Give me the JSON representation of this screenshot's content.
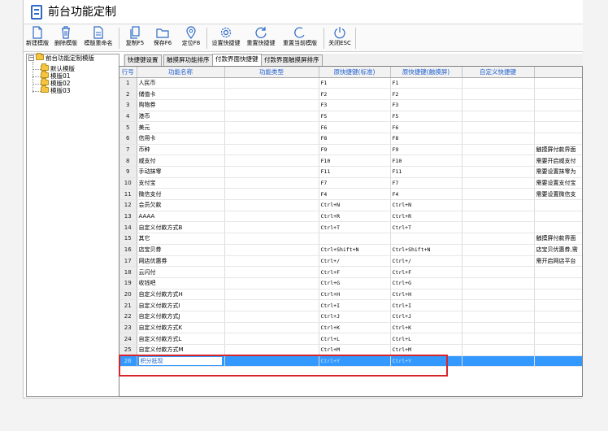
{
  "window": {
    "title": "前台功能定制"
  },
  "toolbar": {
    "buttons": [
      {
        "label": "新建模版",
        "icon": "new-document-icon"
      },
      {
        "label": "删除模版",
        "icon": "trash-icon"
      },
      {
        "label": "模版重命名",
        "icon": "rename-document-icon"
      },
      {
        "label": "复制F5",
        "icon": "copy-icon"
      },
      {
        "label": "保存F6",
        "icon": "folder-icon"
      },
      {
        "label": "定位F8",
        "icon": "location-pin-icon"
      },
      {
        "label": "设置快捷键",
        "icon": "gear-icon"
      },
      {
        "label": "重置快捷键",
        "icon": "refresh-icon"
      },
      {
        "label": "重置当前模版",
        "icon": "reset-icon"
      },
      {
        "label": "关闭ESC",
        "icon": "power-icon"
      }
    ]
  },
  "tree": {
    "root": "前台功能定制模版",
    "items": [
      "默认模版",
      "模版01",
      "模版02",
      "模版03"
    ]
  },
  "tabs": [
    {
      "label": "快捷键设置",
      "active": false
    },
    {
      "label": "触摸屏功能排序",
      "active": false
    },
    {
      "label": "付款界面快捷键",
      "active": true
    },
    {
      "label": "付款界面触摸屏排序",
      "active": false
    }
  ],
  "grid": {
    "columns": [
      "行号",
      "功能名称",
      "功能类型",
      "原快捷键(标准)",
      "原快捷键(触摸屏)",
      "自定义快捷键",
      ""
    ],
    "rows": [
      {
        "no": "1",
        "name": "人民币",
        "type": "",
        "std": "F1",
        "touch": "F1",
        "custom": "",
        "note": ""
      },
      {
        "no": "2",
        "name": "储值卡",
        "type": "",
        "std": "F2",
        "touch": "F2",
        "custom": "",
        "note": ""
      },
      {
        "no": "3",
        "name": "购物券",
        "type": "",
        "std": "F3",
        "touch": "F3",
        "custom": "",
        "note": ""
      },
      {
        "no": "4",
        "name": "港币",
        "type": "",
        "std": "F5",
        "touch": "F5",
        "custom": "",
        "note": ""
      },
      {
        "no": "5",
        "name": "美元",
        "type": "",
        "std": "F6",
        "touch": "F6",
        "custom": "",
        "note": ""
      },
      {
        "no": "6",
        "name": "信用卡",
        "type": "",
        "std": "F8",
        "touch": "F8",
        "custom": "",
        "note": ""
      },
      {
        "no": "7",
        "name": "币种",
        "type": "",
        "std": "F9",
        "touch": "F9",
        "custom": "",
        "note": "触摸屏付款界面"
      },
      {
        "no": "8",
        "name": "威支付",
        "type": "",
        "std": "F10",
        "touch": "F10",
        "custom": "",
        "note": "需要开启威支付"
      },
      {
        "no": "9",
        "name": "手动抹零",
        "type": "",
        "std": "F11",
        "touch": "F11",
        "custom": "",
        "note": "需要设置抹零为"
      },
      {
        "no": "10",
        "name": "支付宝",
        "type": "",
        "std": "F7",
        "touch": "F7",
        "custom": "",
        "note": "需要设置支付宝"
      },
      {
        "no": "11",
        "name": "微信支付",
        "type": "",
        "std": "F4",
        "touch": "F4",
        "custom": "",
        "note": "需要设置微信支"
      },
      {
        "no": "12",
        "name": "会员欠款",
        "type": "",
        "std": "Ctrl+N",
        "touch": "Ctrl+N",
        "custom": "",
        "note": ""
      },
      {
        "no": "13",
        "name": "AAAA",
        "type": "",
        "std": "Ctrl+R",
        "touch": "Ctrl+R",
        "custom": "",
        "note": ""
      },
      {
        "no": "14",
        "name": "自定义付款方式B",
        "type": "",
        "std": "Ctrl+T",
        "touch": "Ctrl+T",
        "custom": "",
        "note": ""
      },
      {
        "no": "15",
        "name": "其它",
        "type": "",
        "std": "",
        "touch": "",
        "custom": "",
        "note": "触摸屏付款界面"
      },
      {
        "no": "16",
        "name": "店宝贝券",
        "type": "",
        "std": "Ctrl+Shift+N",
        "touch": "Ctrl+Shift+N",
        "custom": "",
        "note": "店宝贝优惠券,需"
      },
      {
        "no": "17",
        "name": "网店优惠券",
        "type": "",
        "std": "Ctrl+/",
        "touch": "Ctrl+/",
        "custom": "",
        "note": "需开启网店平台"
      },
      {
        "no": "18",
        "name": "云闪付",
        "type": "",
        "std": "Ctrl+F",
        "touch": "Ctrl+F",
        "custom": "",
        "note": ""
      },
      {
        "no": "19",
        "name": "收钱吧",
        "type": "",
        "std": "Ctrl+G",
        "touch": "Ctrl+G",
        "custom": "",
        "note": ""
      },
      {
        "no": "20",
        "name": "自定义付款方式H",
        "type": "",
        "std": "Ctrl+H",
        "touch": "Ctrl+H",
        "custom": "",
        "note": ""
      },
      {
        "no": "21",
        "name": "自定义付款方式I",
        "type": "",
        "std": "Ctrl+I",
        "touch": "Ctrl+I",
        "custom": "",
        "note": ""
      },
      {
        "no": "22",
        "name": "自定义付款方式J",
        "type": "",
        "std": "Ctrl+J",
        "touch": "Ctrl+J",
        "custom": "",
        "note": ""
      },
      {
        "no": "23",
        "name": "自定义付款方式K",
        "type": "",
        "std": "Ctrl+K",
        "touch": "Ctrl+K",
        "custom": "",
        "note": ""
      },
      {
        "no": "24",
        "name": "自定义付款方式L",
        "type": "",
        "std": "Ctrl+L",
        "touch": "Ctrl+L",
        "custom": "",
        "note": ""
      },
      {
        "no": "25",
        "name": "自定义付款方式M",
        "type": "",
        "std": "Ctrl+M",
        "touch": "Ctrl+M",
        "custom": "",
        "note": ""
      },
      {
        "no": "26",
        "name": "积分抵现",
        "type": "",
        "std": "Ctrl+Y",
        "touch": "Ctrl+Y",
        "custom": "",
        "note": "",
        "selected": true
      }
    ]
  },
  "colors": {
    "header_text": "#1e5fd0",
    "selection": "#3399ff",
    "highlight_box": "#d6262c"
  }
}
